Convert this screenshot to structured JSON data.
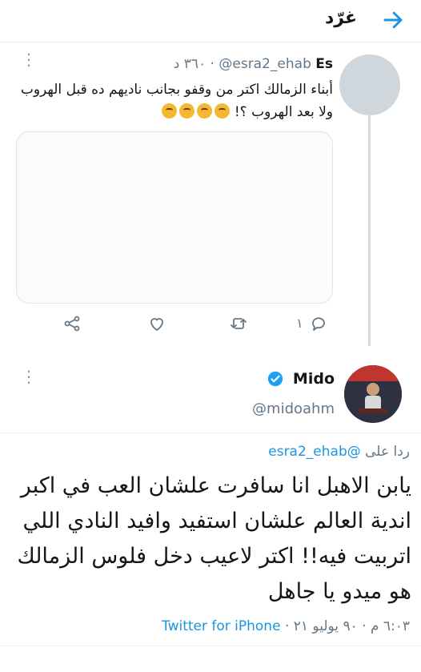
{
  "header": {
    "title": "غرّد"
  },
  "quoted": {
    "name": "Es",
    "handle": "@esra2_ehab",
    "time": "٣٦٠ د",
    "text": "أبناء الزمالك اكتر من وقفو بجانب ناديهم ده قبل الهروب ولا بعد الهروب ؟!",
    "reply_count": "١"
  },
  "tweet": {
    "name": "Mido",
    "handle": "@midoahm",
    "replying_prefix": "ردا على",
    "replying_handle": "@esra2_ehab",
    "body": "يابن الاهبل انا سافرت علشان العب في اكبر اندية العالم علشان استفيد وافيد النادي اللي اتربيت فيه!! اكتر لاعيب دخل فلوس الزمالك هو ميدو يا جاهل",
    "time": "٦:٠٣ م",
    "date": "٩٠ يوليو ٢١",
    "source": "Twitter for iPhone"
  },
  "colors": {
    "accent": "#1b95e0",
    "muted": "#657786",
    "verified": "#1da1f2"
  }
}
